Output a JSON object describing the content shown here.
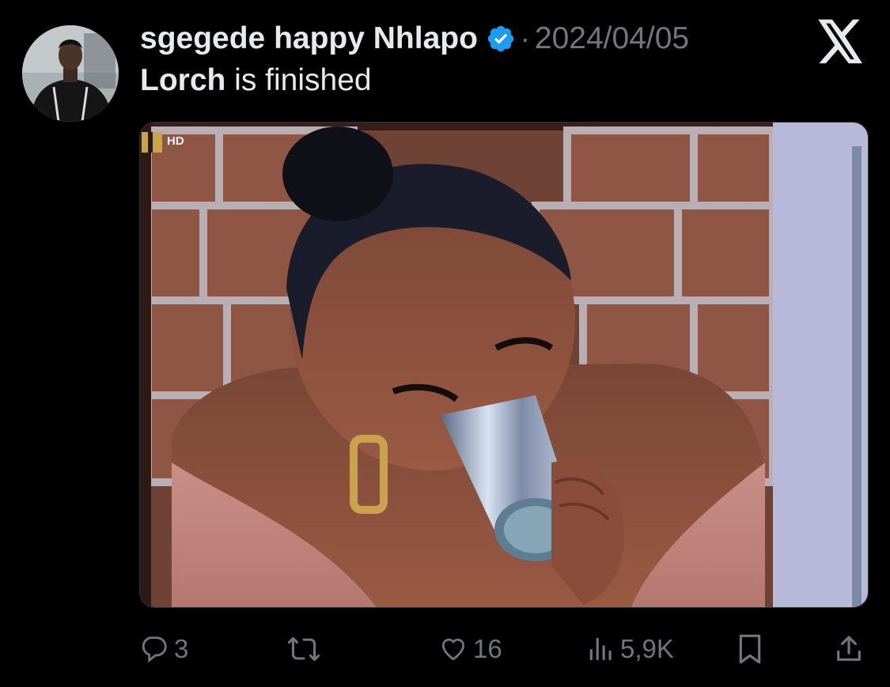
{
  "tweet": {
    "author_name": "sgegede happy Nhlapo",
    "separator": "·",
    "date": "2024/04/05",
    "text_bold": "Lorch",
    "text_rest": " is finished"
  },
  "media": {
    "channel_badge": "HD"
  },
  "actions": {
    "reply_count": "3",
    "like_count": "16",
    "view_count": "5,9K"
  },
  "icons": {
    "verified": "verified-badge-icon",
    "logo": "x-logo-icon",
    "reply": "reply-icon",
    "retweet": "retweet-icon",
    "like": "heart-icon",
    "views": "views-icon",
    "bookmark": "bookmark-icon",
    "share": "share-icon"
  },
  "colors": {
    "background": "#000000",
    "text": "#e7e9ea",
    "muted": "#71767b",
    "verified": "#1d9bf0"
  }
}
